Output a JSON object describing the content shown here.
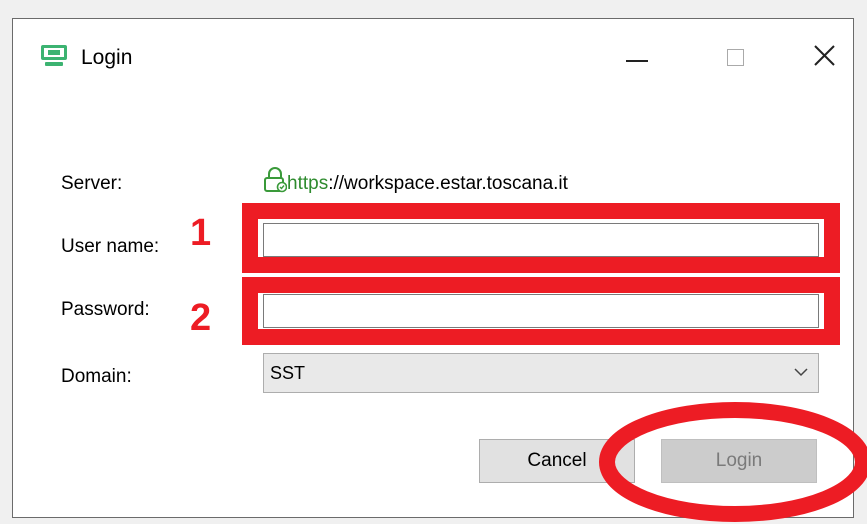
{
  "window": {
    "title": "Login",
    "controls": [
      "minimize",
      "maximize",
      "close"
    ]
  },
  "form": {
    "server_label": "Server:",
    "server_scheme": "https",
    "server_rest": "://workspace.estar.toscana.it",
    "username_label": "User name:",
    "username_value": "",
    "password_label": "Password:",
    "password_value": "",
    "domain_label": "Domain:",
    "domain_value": "SST"
  },
  "buttons": {
    "cancel": "Cancel",
    "login": "Login"
  },
  "annotations": {
    "marker_1": "1",
    "marker_2": "2",
    "color": "#ed1c24"
  },
  "colors": {
    "secure_green": "#2e8b2e",
    "app_icon_green": "#3cb371"
  }
}
